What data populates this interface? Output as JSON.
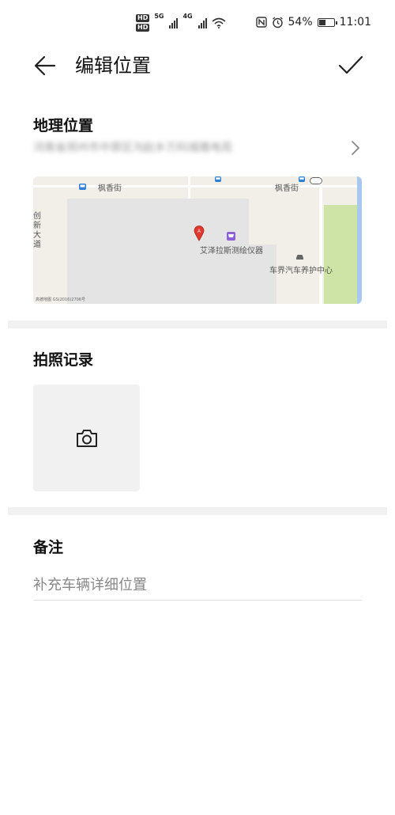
{
  "status_bar": {
    "hd1": "HD",
    "hd2": "HD",
    "net1": "5G",
    "net2": "4G",
    "battery": "54%",
    "battery_level": 0.54,
    "time": "11:01"
  },
  "header": {
    "title": "编辑位置"
  },
  "location": {
    "section_title": "地理位置",
    "address": "河南省郑州市中原区沟赵乡万科城雅电苑",
    "map": {
      "street_top_left": "枫香街",
      "street_top_right": "枫香街",
      "road_left": "创新大道",
      "poi_main": "艾泽拉斯测绘仪器",
      "poi_secondary": "车界汽车养护中心",
      "copyright": "高德地图 GS(2016)2706号",
      "marker_letter": "A"
    }
  },
  "photo": {
    "section_title": "拍照记录"
  },
  "remarks": {
    "section_title": "备注",
    "placeholder": "补充车辆详细位置",
    "value": ""
  }
}
